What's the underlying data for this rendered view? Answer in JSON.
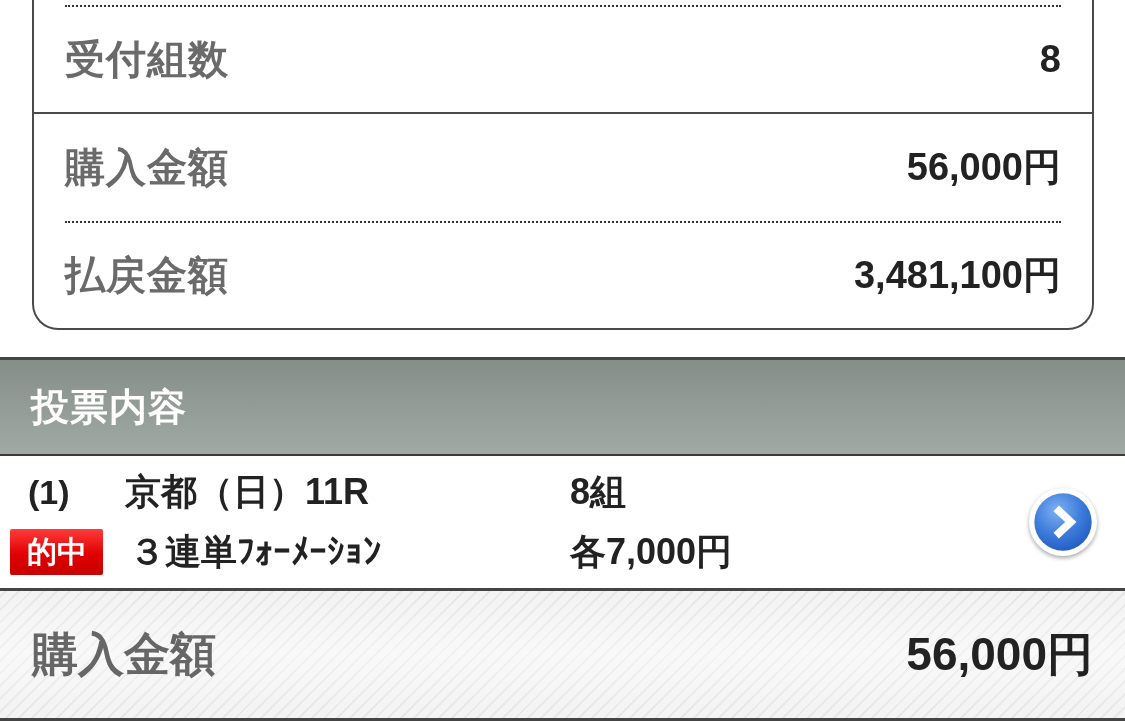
{
  "summary": {
    "groups": [
      {
        "rows": [
          {
            "label": "受付組数",
            "value": "8"
          }
        ]
      },
      {
        "rows": [
          {
            "label": "購入金額",
            "value": "56,000円"
          },
          {
            "label": "払戻金額",
            "value": "3,481,100円"
          }
        ]
      }
    ]
  },
  "section": {
    "title": "投票内容"
  },
  "bets": [
    {
      "number": "(1)",
      "venue_race": "京都（日）11R",
      "combinations": "8組",
      "hit": true,
      "badge": "的中",
      "bet_type": "３連単ﾌｫｰﾒｰｼｮﾝ",
      "amount_each": "各7,000円"
    }
  ],
  "total": {
    "label": "購入金額",
    "value": "56,000円"
  }
}
